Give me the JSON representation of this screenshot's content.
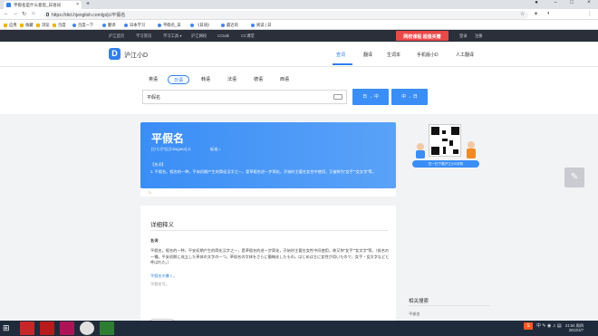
{
  "browser": {
    "tab_title": "平假名是什么意思_日语词",
    "url": "https://dict.hjenglish.com/jp/jc/平假名",
    "bookmarks": [
      "应用",
      "收藏",
      "浏览",
      "百度",
      "百度一下",
      "翻译",
      "日本学习",
      "平假名_日",
      "《日语》",
      "最近的",
      "阅读 | 日"
    ]
  },
  "site_nav": {
    "items": [
      "沪江首页",
      "学习资讯",
      "学习工具 ▾",
      "沪江网校",
      "CCtalk",
      "CC课堂"
    ],
    "promo": "网校课程 超值买赠",
    "login": "登录",
    "register": "注册"
  },
  "header": {
    "logo_letter": "D",
    "logo_text": "沪江小D",
    "nav": [
      "查词",
      "翻译",
      "生词本",
      "手机版小D",
      "人工翻译"
    ],
    "active": "查词"
  },
  "search": {
    "langs": [
      "英语",
      "日语",
      "韩语",
      "法语",
      "德语",
      "西语"
    ],
    "selected_lang": "日语",
    "query": "平假名",
    "btn_jc": "日 → 中",
    "btn_cj": "中 → 日"
  },
  "result": {
    "word": "平假名",
    "pron": "[ひらがな] [hiragana] ◎",
    "speaker": "标准 ♪",
    "def_label": "【名词】",
    "def": "1. 平假名。假名的一种，平安初期产生的简化汉字之一，是草假名进一步简化，开始时主要在女性中使用，又被称为“女手”“女文字”等。"
  },
  "sidebar": {
    "qr_caption": "扫一扫下载沪江小D手机",
    "related_title": "相关搜索",
    "related_item": "平仮名"
  },
  "detail": {
    "title": "详细释义",
    "pos": "名词",
    "text": "平假名。假名的一种，平安初期产生的简化汉字之一，是草假名的进一步简化，开始时主要在女性中间使用，故又称“女手”“女文字”等。（仮名の一種。平安初期に成立した草体の文字の一つ。草仮名の字体をさらに簡略化したもの。はじめは主に女性が用いたので，女手・女文字などと呼ばれた。）",
    "more": "平假名の書く。",
    "bottom": "平假名写。"
  },
  "taskbar": {
    "clock_time": "21:54 周四",
    "clock_date": "2022/4/7",
    "tray_text": "中 ✎ ◉ ♫ ▤"
  },
  "icons": [
    "search-icon",
    "back-icon",
    "forward-icon",
    "refresh-icon",
    "home-icon",
    "star-icon",
    "speaker-icon",
    "flame-icon",
    "keyboard-icon",
    "edit-icon"
  ]
}
